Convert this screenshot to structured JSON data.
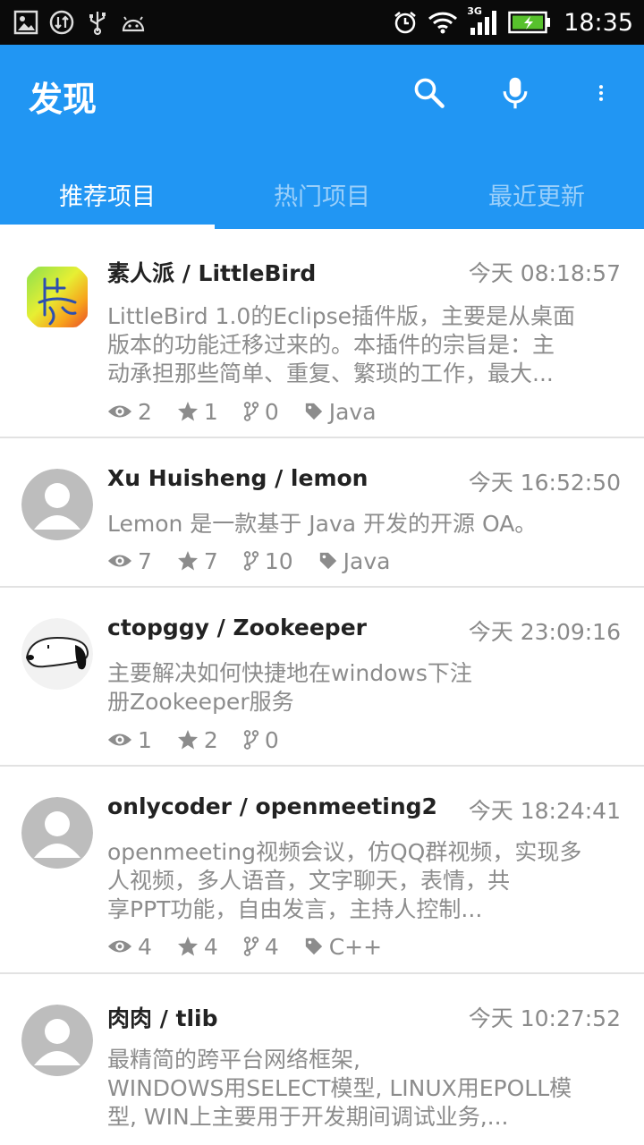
{
  "status_bar": {
    "left_icons": [
      "gallery-icon",
      "sync-icon",
      "usb-icon",
      "android-icon"
    ],
    "right_icons": [
      "alarm-icon",
      "wifi-icon",
      "signal-3g-icon",
      "battery-charging-icon"
    ],
    "network": "3G",
    "time": "18:35"
  },
  "app_bar": {
    "title": "发现",
    "icons": [
      "search-icon",
      "mic-icon",
      "more-vert-icon"
    ]
  },
  "tabs": [
    {
      "label": "推荐项目",
      "active": true
    },
    {
      "label": "热门项目",
      "active": false
    },
    {
      "label": "最近更新",
      "active": false
    }
  ],
  "projects": [
    {
      "title": "素人派 / LittleBird",
      "time": "今天 08:18:57",
      "desc_lines": [
        "LittleBird 1.0的Eclipse插件版，主要是从桌面",
        "版本的功能迁移过来的。本插件的宗旨是：主",
        "动承担那些简单、重复、繁琐的工作，最大..."
      ],
      "views": "2",
      "stars": "1",
      "forks": "0",
      "lang": "Java",
      "avatar": "seal-logo"
    },
    {
      "title": "Xu Huisheng / lemon",
      "time": "今天 16:52:50",
      "desc_lines": [
        "Lemon 是一款基于 Java 开发的开源 OA。"
      ],
      "views": "7",
      "stars": "7",
      "forks": "10",
      "lang": "Java",
      "avatar": "default-user"
    },
    {
      "title": "ctopggy / Zookeeper",
      "time": "今天 23:09:16",
      "desc_lines": [
        "主要解决如何快捷地在windows下注",
        "册Zookeeper服务"
      ],
      "views": "1",
      "stars": "2",
      "forks": "0",
      "lang": "",
      "avatar": "snoopy"
    },
    {
      "title": "onlycoder / openmeeting2",
      "time": "今天 18:24:41",
      "desc_lines": [
        "openmeeting视频会议，仿QQ群视频，实现多",
        "人视频，多人语音，文字聊天，表情，共",
        "享PPT功能，自由发言，主持人控制..."
      ],
      "views": "4",
      "stars": "4",
      "forks": "4",
      "lang": "C++",
      "avatar": "default-user"
    },
    {
      "title": "肉肉 / tlib",
      "time": "今天 10:27:52",
      "desc_lines": [
        "最精简的跨平台网络框架,",
        "WINDOWS用SELECT模型, LINUX用EPOLL模",
        "型, WIN上主要用于开发期间调试业务,..."
      ],
      "views": "",
      "stars": "",
      "forks": "",
      "lang": "",
      "avatar": "default-user"
    }
  ],
  "colors": {
    "primary": "#2196f3",
    "status_bar": "#0a0a0a",
    "title_text": "#222222",
    "meta_text": "#8c8c8c",
    "divider": "#e2e2e2"
  }
}
